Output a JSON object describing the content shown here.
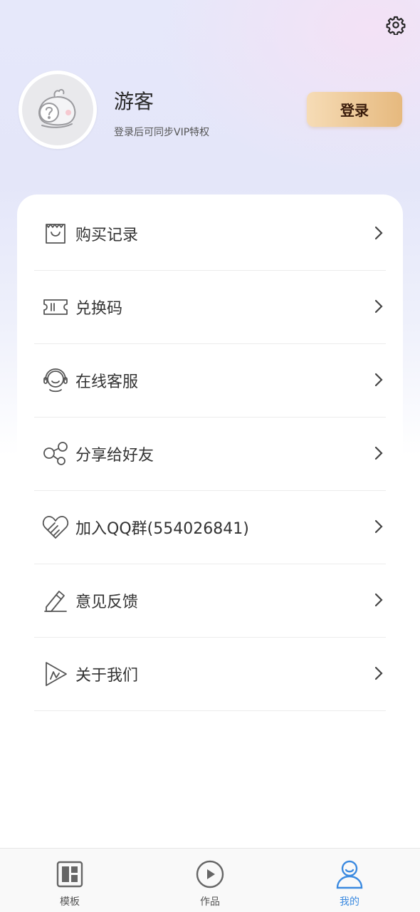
{
  "profile": {
    "name": "游客",
    "subtitle": "登录后可同步VIP特权",
    "login_label": "登录",
    "avatar_icon": "question-mascot-icon"
  },
  "header": {
    "settings_icon": "gear-icon"
  },
  "menu": {
    "items": [
      {
        "label": "购买记录",
        "icon": "shopping-bag-icon"
      },
      {
        "label": "兑换码",
        "icon": "ticket-icon"
      },
      {
        "label": "在线客服",
        "icon": "headset-agent-icon"
      },
      {
        "label": "分享给好友",
        "icon": "share-icon"
      },
      {
        "label": "加入QQ群(554026841)",
        "icon": "handshake-heart-icon"
      },
      {
        "label": "意见反馈",
        "icon": "pencil-icon"
      },
      {
        "label": "关于我们",
        "icon": "app-logo-icon"
      }
    ]
  },
  "tabbar": {
    "tabs": [
      {
        "label": "模板",
        "icon": "template-grid-icon",
        "active": false
      },
      {
        "label": "作品",
        "icon": "play-circle-icon",
        "active": false
      },
      {
        "label": "我的",
        "icon": "person-icon",
        "active": true
      }
    ]
  },
  "colors": {
    "accent": "#3b8ae0",
    "login_gradient_start": "#f6dcb6",
    "login_gradient_end": "#e6b97e"
  }
}
